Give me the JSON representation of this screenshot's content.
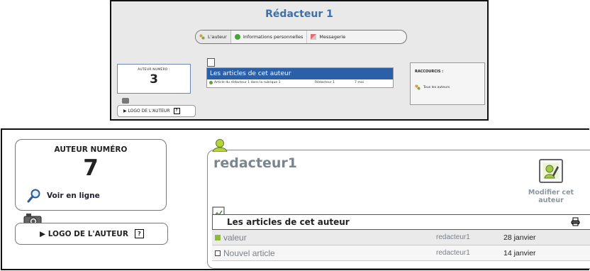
{
  "preview": {
    "title": "Rédacteur 1",
    "tabs": [
      {
        "label": "L'auteur",
        "icon": "authors-icon"
      },
      {
        "label": "Informations personnelles",
        "icon": "info-icon"
      },
      {
        "label": "Messagerie",
        "icon": "mail-icon"
      }
    ],
    "author_label": "AUTEUR NUMÉRO :",
    "author_number": "3",
    "logo_label": "LOGO DE L'AUTEUR",
    "articles_title": "Les articles de cet auteur",
    "article_row": {
      "title": "Article du rédacteur 1 dans la rubrique 1",
      "author": "Rédacteur 1",
      "date": "7 mai"
    },
    "shortcuts_label": "RACCOURCIS :",
    "shortcuts_item": "Tous les auteurs"
  },
  "main": {
    "author_label": "AUTEUR NUMÉRO",
    "author_number": "7",
    "view_online": "Voir en ligne",
    "logo_label": "LOGO DE L'AUTEUR",
    "help_glyph": "?",
    "username": "redacteur1",
    "modify_label": "Modifier cet auteur",
    "articles_title": "Les articles de cet auteur",
    "articles": [
      {
        "title": "valeur",
        "author": "redacteur1",
        "date": "28 janvier",
        "status_color": "#8cbd3a"
      },
      {
        "title": "Nouvel article",
        "author": "redacteur1",
        "date": "14 janvier",
        "status_color": "#ffffff"
      }
    ]
  },
  "colors": {
    "accent": "#2b5fa7",
    "title_gray": "#7a868e"
  }
}
